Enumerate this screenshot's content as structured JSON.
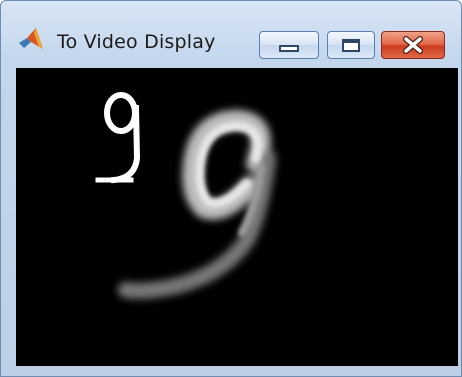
{
  "window": {
    "title": "To Video Display",
    "app_icon": "matlab-icon"
  },
  "titlebar_buttons": {
    "minimize": "minimize-icon",
    "maximize": "maximize-icon",
    "close": "close-icon"
  },
  "colors": {
    "frame": "#c3d6ec",
    "close_button": "#d9533a",
    "video_background": "#000000"
  }
}
